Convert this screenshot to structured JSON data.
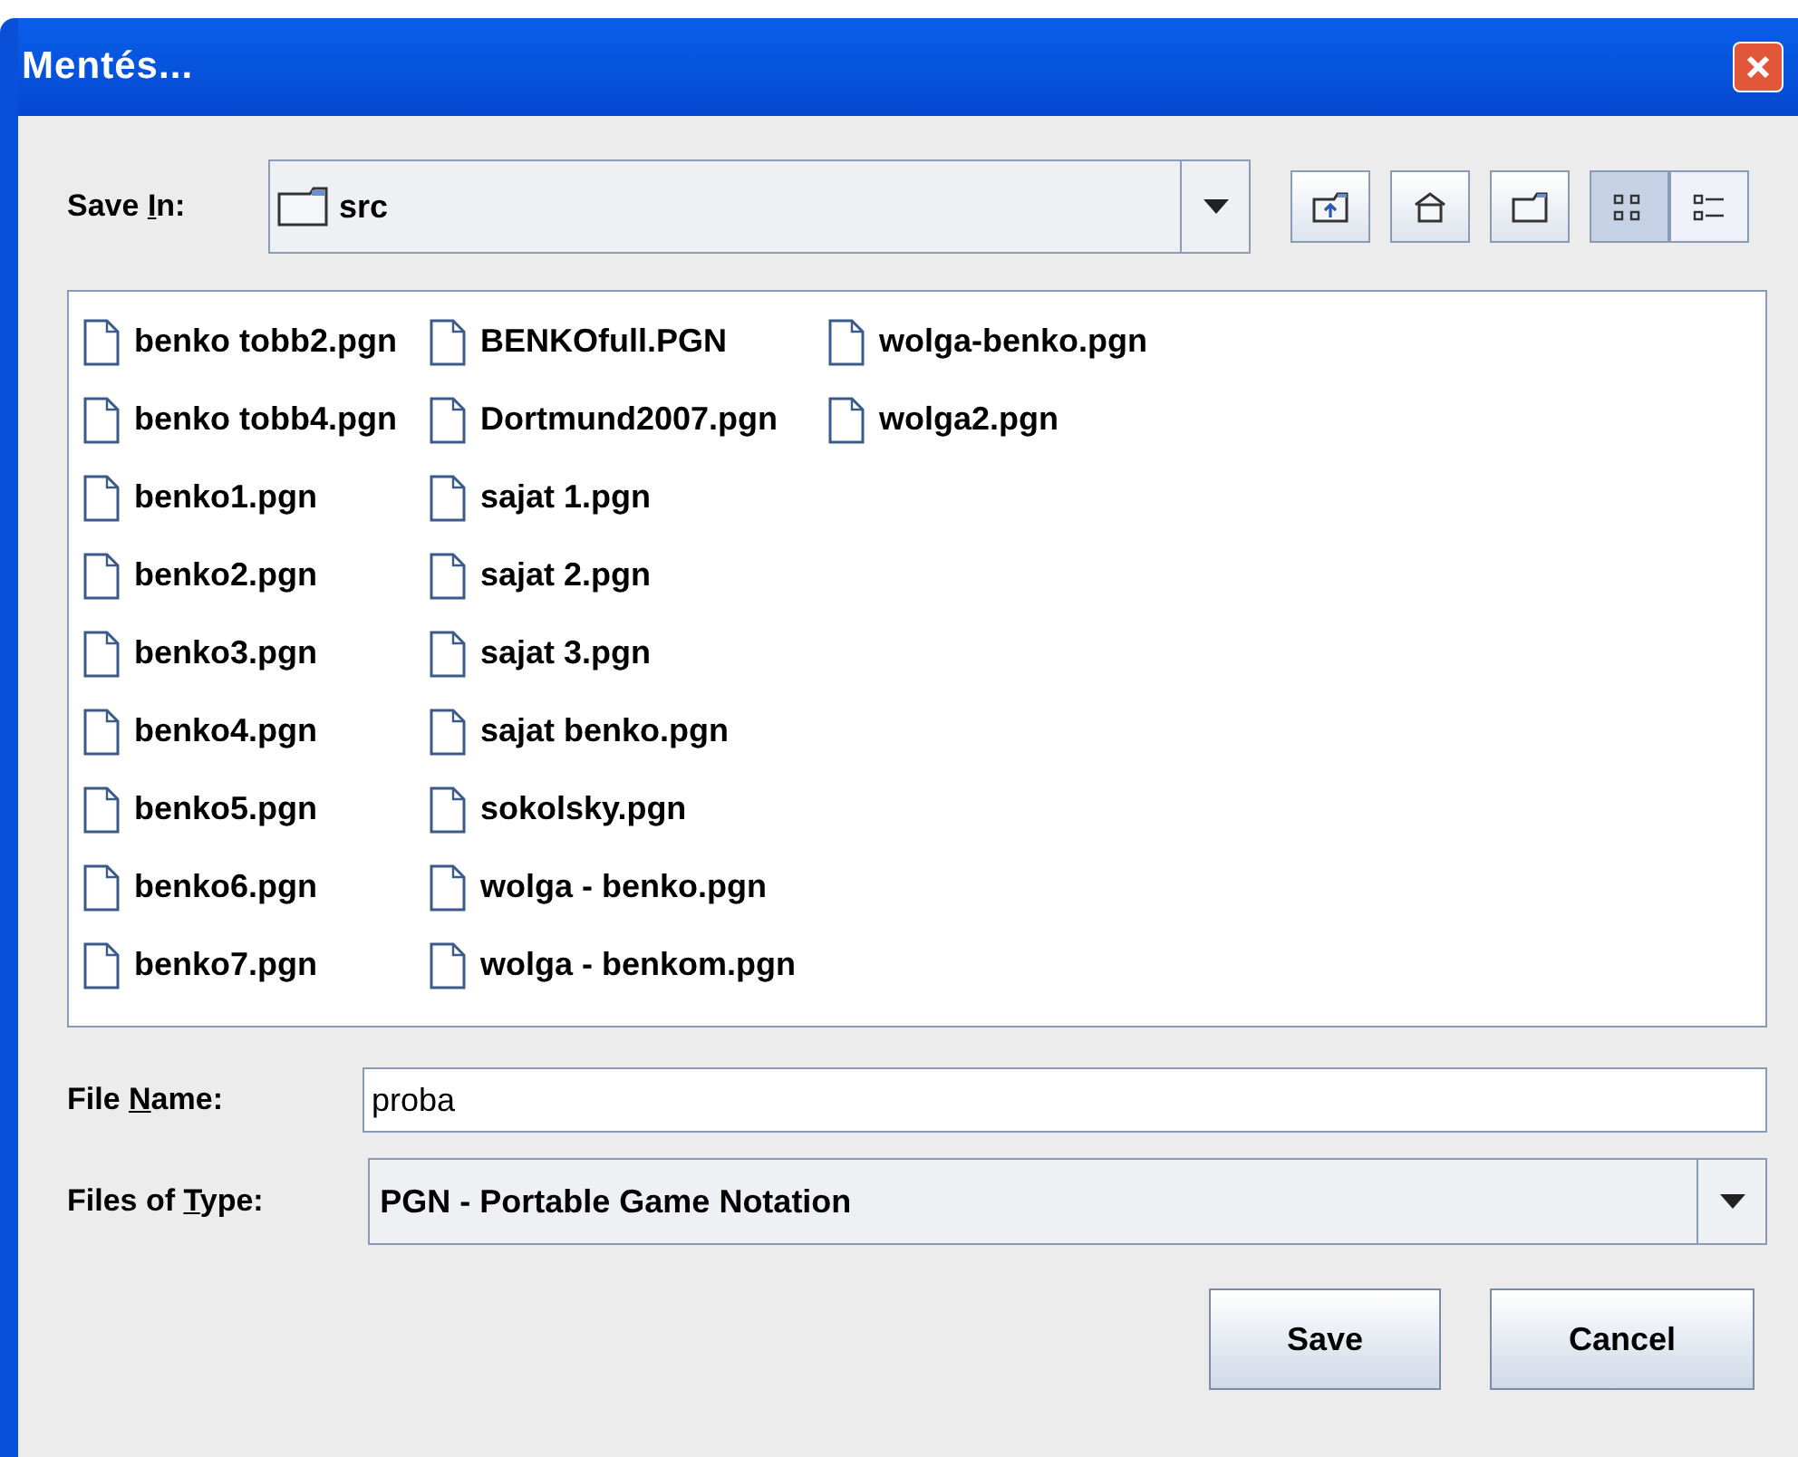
{
  "window": {
    "title": "Mentés..."
  },
  "save_in": {
    "label": {
      "before": "Save ",
      "mnemonic": "I",
      "after": "n:"
    },
    "value": "src"
  },
  "toolbar": [
    {
      "kind": "up"
    },
    {
      "kind": "home"
    },
    {
      "kind": "newfolder"
    },
    {
      "kind": "list",
      "selected": true
    },
    {
      "kind": "details",
      "selected": false
    }
  ],
  "files": [
    {
      "name": "benko tobb2.pgn"
    },
    {
      "name": "benko tobb4.pgn"
    },
    {
      "name": "benko1.pgn"
    },
    {
      "name": "benko2.pgn"
    },
    {
      "name": "benko3.pgn"
    },
    {
      "name": "benko4.pgn"
    },
    {
      "name": "benko5.pgn"
    },
    {
      "name": "benko6.pgn"
    },
    {
      "name": "benko7.pgn"
    },
    {
      "name": "BENKOfull.PGN"
    },
    {
      "name": "Dortmund2007.pgn"
    },
    {
      "name": "sajat 1.pgn"
    },
    {
      "name": "sajat 2.pgn"
    },
    {
      "name": "sajat 3.pgn"
    },
    {
      "name": "sajat benko.pgn"
    },
    {
      "name": "sokolsky.pgn"
    },
    {
      "name": "wolga - benko.pgn"
    },
    {
      "name": "wolga - benkom.pgn"
    },
    {
      "name": "wolga-benko.pgn"
    },
    {
      "name": "wolga2.pgn"
    }
  ],
  "file_name": {
    "label": {
      "before": "File ",
      "mnemonic": "N",
      "after": "ame:"
    },
    "value": "proba"
  },
  "file_type": {
    "label": {
      "before": "Files of ",
      "mnemonic": "T",
      "after": "ype:"
    },
    "value": "PGN - Portable Game Notation"
  },
  "buttons": [
    "Save",
    "Cancel"
  ]
}
